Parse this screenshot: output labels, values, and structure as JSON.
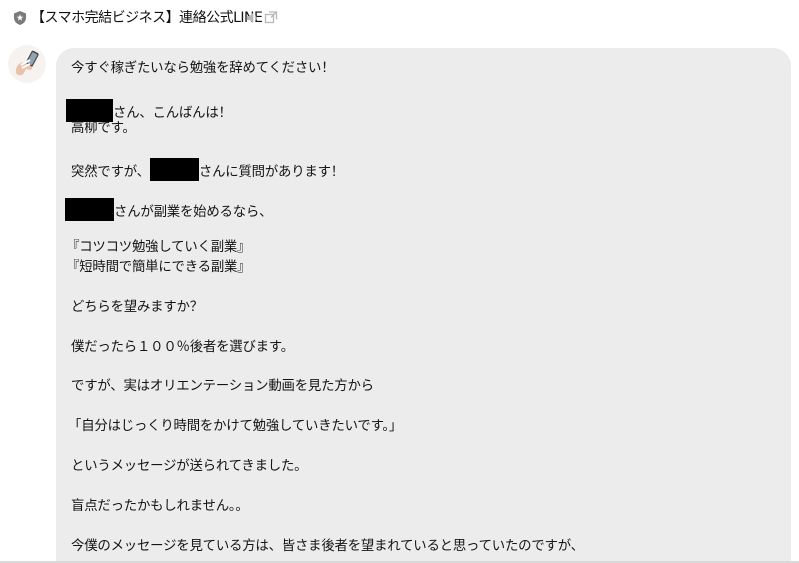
{
  "header": {
    "title": "【スマホ完結ビジネス】連絡公式LINE",
    "icons": [
      "shield-icon",
      "speaker-mute-icon",
      "share-icon"
    ]
  },
  "message": {
    "sender_avatar": "hand-holding-smartphone",
    "lines": [
      {
        "prefix": "",
        "suffix": "今すぐ稼ぎたいなら勉強を辞めてください！"
      },
      {
        "prefix": "",
        "suffix": "さん、こんばんは！"
      },
      {
        "prefix": "",
        "suffix": "高柳です。"
      },
      {
        "prefix": "突然ですが、",
        "suffix": "さんに質問があります！"
      },
      {
        "prefix": "",
        "suffix": "さんが副業を始めるなら、"
      },
      {
        "prefix": "",
        "suffix": "『コツコツ勉強していく副業』"
      },
      {
        "prefix": "",
        "suffix": "『短時間で簡単にできる副業』"
      },
      {
        "prefix": "",
        "suffix": "どちらを望みますか？"
      },
      {
        "prefix": "",
        "suffix": "僕だったら１００％後者を選びます。"
      },
      {
        "prefix": "",
        "suffix": "ですが、実はオリエンテーション動画を見た方から"
      },
      {
        "prefix": "",
        "suffix": "「自分はじっくり時間をかけて勉強していきたいです。」"
      },
      {
        "prefix": "",
        "suffix": "というメッセージが送られてきました。"
      },
      {
        "prefix": "",
        "suffix": "盲点だったかもしれません。。"
      },
      {
        "prefix": "",
        "suffix": "今僕のメッセージを見ている方は、皆さま後者を望まれていると思っていたのですが、"
      }
    ]
  },
  "colors": {
    "bubble": "#ececec",
    "redaction": "#000000",
    "text": "#141414"
  }
}
